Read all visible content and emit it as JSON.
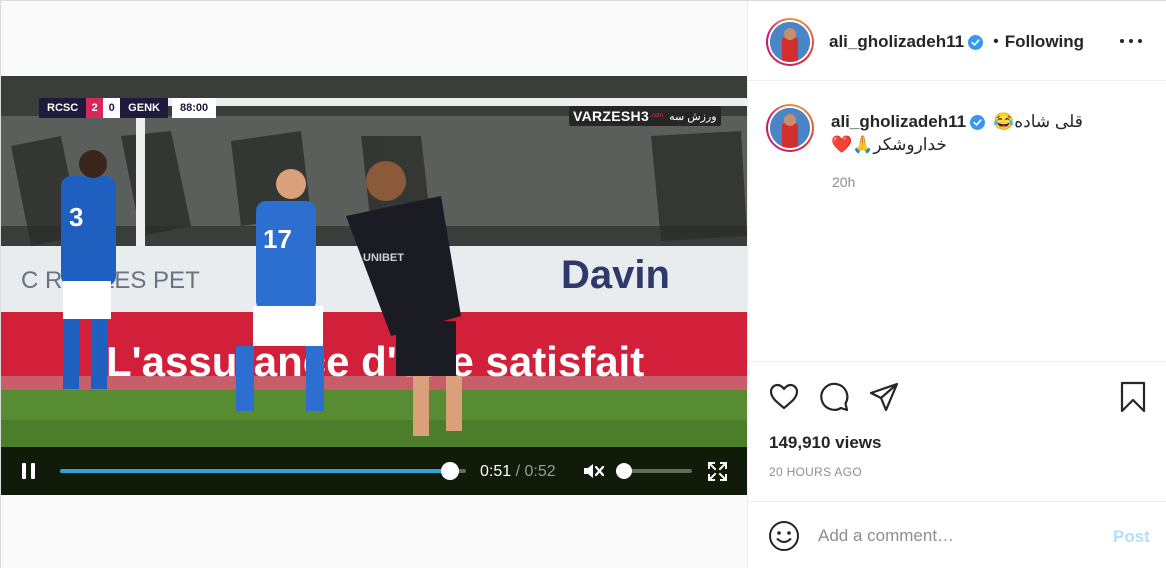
{
  "header": {
    "username": "ali_gholizadeh11",
    "separator": "•",
    "follow_state": "Following",
    "more_icon": "more-horizontal-icon"
  },
  "caption": {
    "username": "ali_gholizadeh11",
    "line1": "قلی شاده😂",
    "line2": "❤️🙏خداروشکر",
    "time": "20h"
  },
  "video": {
    "scoreboard": {
      "home_team": "RCSC",
      "home_score": "2",
      "away_score": "0",
      "away_team": "GENK",
      "clock": "88:00"
    },
    "watermark": {
      "main": "VARZESH3",
      "sub": ".com",
      "fa": "ورزش سه"
    },
    "player": {
      "current_time": "0:51",
      "separator": "/",
      "duration": "0:52",
      "progress": 0.96,
      "volume": 0,
      "muted": true
    },
    "accent_color": "#2fa4dc"
  },
  "actions": {
    "like_icon": "heart-icon",
    "comment_icon": "comment-icon",
    "share_icon": "share-icon",
    "save_icon": "bookmark-icon"
  },
  "stats": {
    "views": "149,910 views",
    "posted": "20 HOURS AGO"
  },
  "comment_box": {
    "placeholder": "Add a comment…",
    "post_label": "Post",
    "post_color": "#b2dffc"
  }
}
